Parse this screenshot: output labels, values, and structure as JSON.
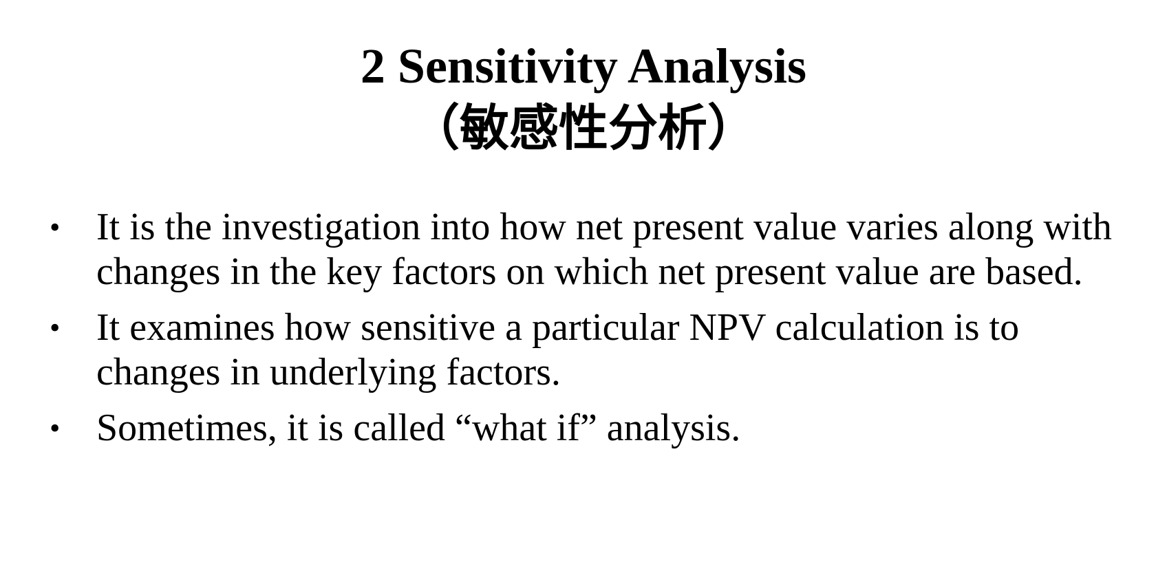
{
  "title": "2 Sensitivity Analysis",
  "subtitle": "（敏感性分析）",
  "bullet_glyph": "•",
  "bullets": [
    {
      "text": "It is the investigation into how net present value varies along with changes in the key factors on which net present value are based."
    },
    {
      "text": "It examines how sensitive a particular NPV calculation is to changes in underlying factors."
    },
    {
      "text": "Sometimes, it is called “what if” analysis."
    }
  ]
}
